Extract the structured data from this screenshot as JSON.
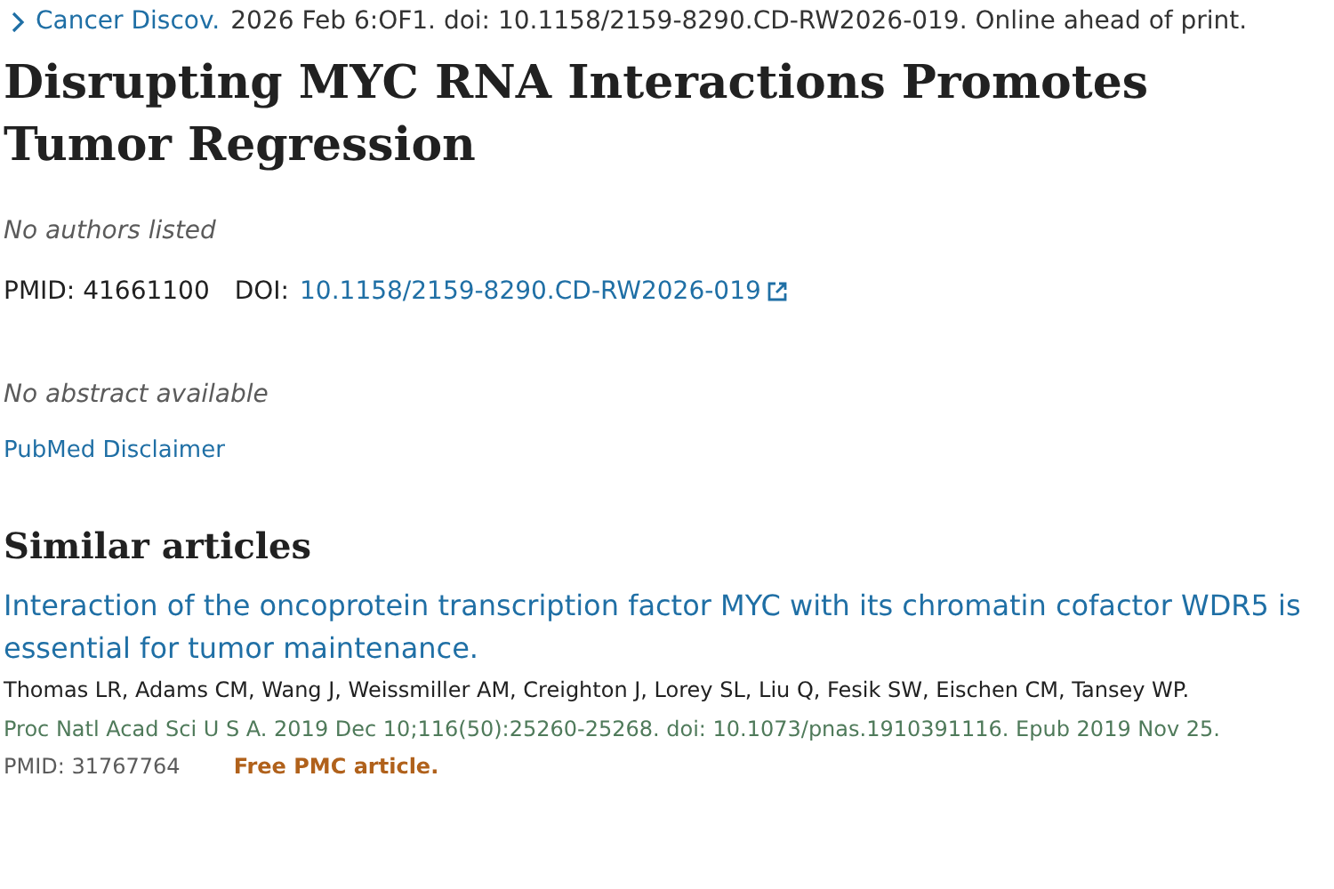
{
  "citation": {
    "journal": "Cancer Discov.",
    "details": "2026 Feb 6:OF1. doi: 10.1158/2159-8290.CD-RW2026-019. Online ahead of print."
  },
  "title": "Disrupting MYC RNA Interactions Promotes Tumor Regression",
  "authors": "No authors listed",
  "ids": {
    "pmid": "PMID: 41661100",
    "doi_label": "DOI:",
    "doi": "10.1158/2159-8290.CD-RW2026-019"
  },
  "abstract": "No abstract available",
  "disclaimer": "PubMed Disclaimer",
  "similar": {
    "heading": "Similar articles",
    "articles": [
      {
        "title": "Interaction of the oncoprotein transcription factor MYC with its chromatin cofactor WDR5 is essential for tumor maintenance.",
        "authors": "Thomas LR, Adams CM, Wang J, Weissmiller AM, Creighton J, Lorey SL, Liu Q, Fesik SW, Eischen CM, Tansey WP.",
        "source": "Proc Natl Acad Sci U S A. 2019 Dec 10;116(50):25260-25268. doi: 10.1073/pnas.1910391116. Epub 2019 Nov 25.",
        "pmid": "PMID: 31767764",
        "free": "Free PMC article."
      }
    ]
  }
}
